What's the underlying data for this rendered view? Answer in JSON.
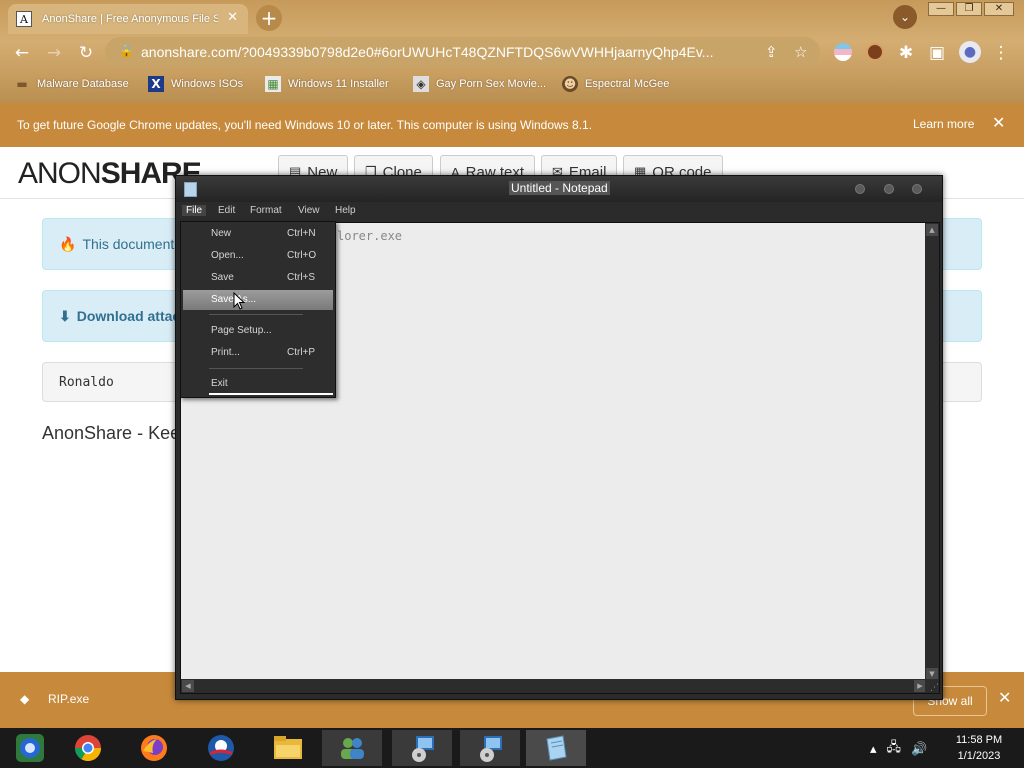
{
  "browser": {
    "tab_title": "AnonShare | Free Anonymous File Sharing",
    "url": "anonshare.com/?0049339b0798d2e0#6orUWUHcT48QZNFTDQS6wVWHHjaarnyQhp4Ev...",
    "bookmarks": [
      {
        "label": "Malware Database",
        "icon": "folder-icon"
      },
      {
        "label": "Windows ISOs",
        "icon": "x-icon"
      },
      {
        "label": "Windows 11 Installer",
        "icon": "image-icon"
      },
      {
        "label": "Gay Porn Sex Movie...",
        "icon": "site-icon"
      },
      {
        "label": "Espectral McGee",
        "icon": "avatar-icon"
      }
    ],
    "infobar": {
      "message": "To get future Google Chrome updates, you'll need Windows 10 or later. This computer is using Windows 8.1.",
      "link": "Learn more"
    }
  },
  "page": {
    "logo_light": "ANON",
    "logo_bold": "SHARE",
    "buttons": [
      "New",
      "Clone",
      "Raw text",
      "Email",
      "QR code"
    ],
    "alert_text": "This document w",
    "download_text": "Download attac",
    "content_text": "Ronaldo",
    "footer_text": "AnonShare - Kee"
  },
  "notepad": {
    "title": "Untitled - Notepad",
    "menus": [
      "File",
      "Edit",
      "Format",
      "View",
      "Help"
    ],
    "body_text": "lorer.exe",
    "file_menu": [
      {
        "label": "New",
        "shortcut": "Ctrl+N"
      },
      {
        "label": "Open...",
        "shortcut": "Ctrl+O"
      },
      {
        "label": "Save",
        "shortcut": "Ctrl+S"
      },
      {
        "label": "Save As...",
        "shortcut": ""
      },
      {
        "label": "Page Setup...",
        "shortcut": ""
      },
      {
        "label": "Print...",
        "shortcut": "Ctrl+P"
      },
      {
        "label": "Exit",
        "shortcut": ""
      }
    ],
    "highlighted_item": "Save As..."
  },
  "download_bar": {
    "file_name": "RIP.exe",
    "show_all": "Show all"
  },
  "taskbar": {
    "apps": [
      "chrome-old-icon",
      "chrome-icon",
      "firefox-icon",
      "obama-icon",
      "file-explorer-icon",
      "users-icon",
      "setup-icon",
      "setup-icon-2",
      "notepad-icon"
    ],
    "time": "11:58 PM",
    "date": "1/1/2023"
  },
  "colors": {
    "chrome_theme": "#c69a5a",
    "infobar": "#c78a3c",
    "alert_bg": "#d9edf7",
    "alert_text": "#31708f",
    "notepad_dark": "#2b2b2b"
  }
}
